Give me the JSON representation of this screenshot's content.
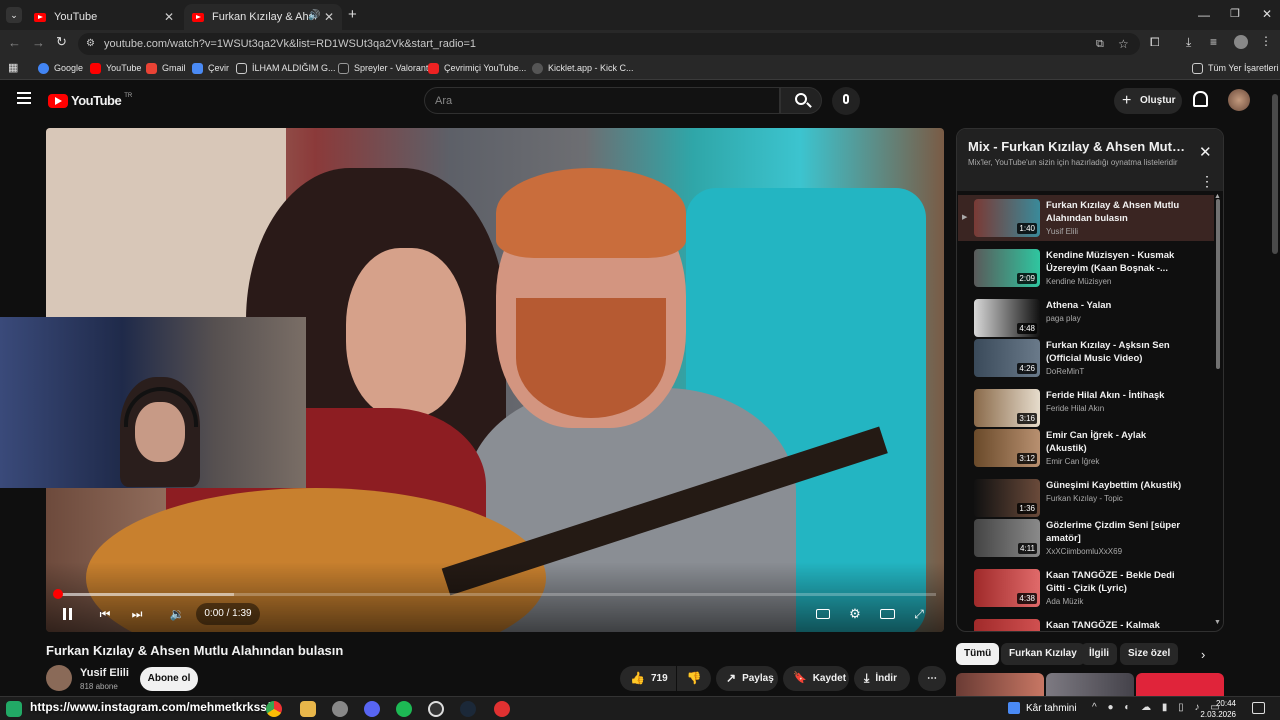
{
  "browser": {
    "tabs": [
      {
        "label": "YouTube"
      },
      {
        "label": "Furkan Kızılay & Ahsen Mutlu"
      }
    ],
    "url": "youtube.com/watch?v=1WSUt3qa2Vk&list=RD1WSUt3qa2Vk&start_radio=1",
    "bookmarks": [
      "Google",
      "YouTube",
      "Gmail",
      "Çevir",
      "İLHAM ALDIĞIM G...",
      "Spreyler - Valorant",
      "Çevrimiçi YouTube...",
      "Kicklet.app - Kick C..."
    ],
    "all_bookmarks": "Tüm Yer İşaretleri"
  },
  "yt": {
    "logo": "YouTube",
    "region": "TR",
    "search_placeholder": "Ara",
    "create_label": "Oluştur"
  },
  "player": {
    "time": "0:00 / 1:39",
    "progress_buffered_fraction": 0.2
  },
  "video": {
    "title": "Furkan Kızılay & Ahsen Mutlu Alahından bulasın",
    "channel": "Yusif Elili",
    "subscribers": "818 abone",
    "subscribe_label": "Abone ol",
    "likes": "719",
    "share_label": "Paylaş",
    "save_label": "Kaydet",
    "download_label": "İndir"
  },
  "playlist": {
    "title": "Mix - Furkan Kızılay & Ahsen Mutlu...",
    "subtitle": "Mix'ler, YouTube'un sizin için hazırladığı oynatma listeleridir",
    "items": [
      {
        "title": "Furkan Kızılay & Ahsen Mutlu Alahından bulasın",
        "channel": "Yusif Elili",
        "duration": "1:40",
        "active": true
      },
      {
        "title": "Kendine Müzisyen - Kusmak Üzereyim (Kaan Boşnak -...",
        "channel": "Kendine Müzisyen",
        "duration": "2:09"
      },
      {
        "title": "Athena - Yalan",
        "channel": "paga play",
        "duration": "4:48"
      },
      {
        "title": "Furkan Kızılay - Aşksın Sen (Official Music Video)",
        "channel": "DoReMinT",
        "duration": "4:26"
      },
      {
        "title": "Feride Hilal Akın - İntihaşk",
        "channel": "Feride Hilal Akın",
        "duration": "3:16"
      },
      {
        "title": "Emir Can İğrek - Aylak (Akustik)",
        "channel": "Emir Can İğrek",
        "duration": "3:12"
      },
      {
        "title": "Güneşimi Kaybettim (Akustik)",
        "channel": "Furkan Kızılay - Topic",
        "duration": "1:36"
      },
      {
        "title": "Gözlerime Çizdim Seni [süper amatör]",
        "channel": "XxXCiimbomluXxX69",
        "duration": "4:11"
      },
      {
        "title": "Kaan TANGÖZE - Bekle Dedi Gitti - Çizik (Lyric)",
        "channel": "Ada Müzik",
        "duration": "4:38"
      },
      {
        "title": "Kaan TANGÖZE - Kalmak Türküsü (Lyric)",
        "channel": "",
        "duration": ""
      }
    ]
  },
  "chips": [
    "Tümü",
    "Furkan Kızılay",
    "İlgili",
    "Size özel"
  ],
  "overlay": {
    "instagram": "https://www.instagram.com/mehmetkrkss/"
  },
  "taskbar": {
    "weather": "Kâr tahmini",
    "time": "20:44",
    "date": "2.03.2026"
  },
  "colors": {
    "accent": "#ff0000",
    "bg": "#0f0f0f",
    "pill": "#272727"
  }
}
